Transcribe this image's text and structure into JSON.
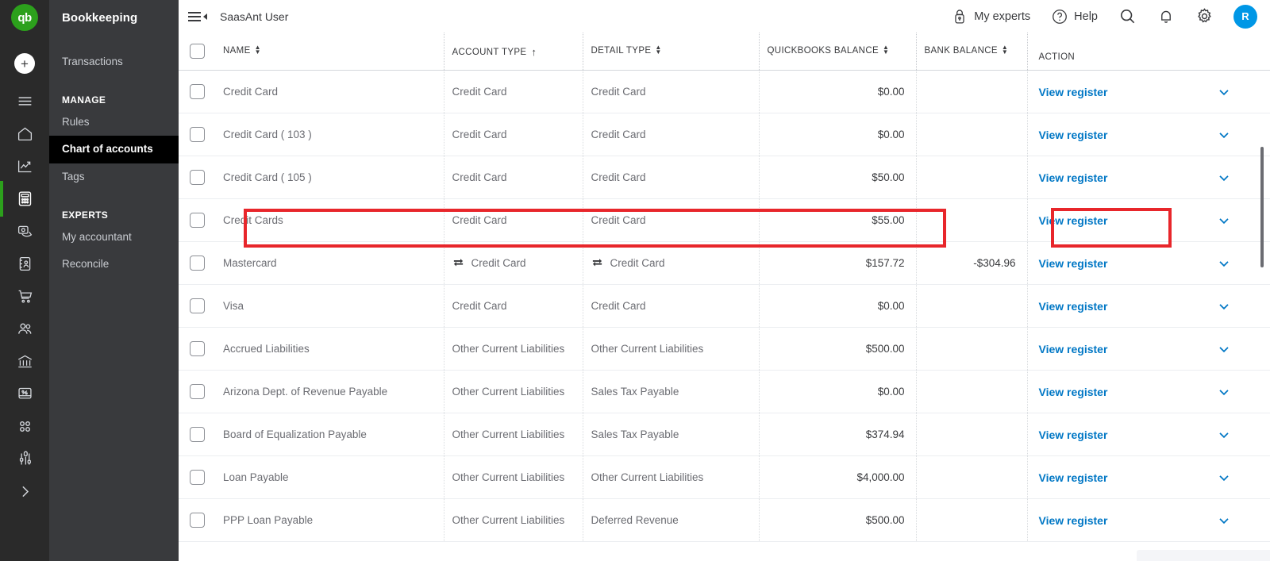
{
  "rail": {
    "logo_text": "qb",
    "add_label": "+",
    "icons": [
      {
        "name": "menu-icon",
        "label": "Menu"
      },
      {
        "name": "home-icon",
        "label": "Home"
      },
      {
        "name": "business-overview-icon",
        "label": "Business overview"
      },
      {
        "name": "bookkeeping-icon",
        "label": "Bookkeeping"
      },
      {
        "name": "sales-icon",
        "label": "Sales"
      },
      {
        "name": "expenses-icon",
        "label": "Expenses"
      },
      {
        "name": "cart-icon",
        "label": "Commerce"
      },
      {
        "name": "customers-icon",
        "label": "Customers & leads"
      },
      {
        "name": "payroll-icon",
        "label": "Payroll"
      },
      {
        "name": "taxes-icon",
        "label": "Taxes"
      },
      {
        "name": "apps-icon",
        "label": "Apps"
      },
      {
        "name": "tools-icon",
        "label": "My accountant"
      },
      {
        "name": "chevron-right-icon",
        "label": "Expand"
      }
    ]
  },
  "sidebar": {
    "title": "Bookkeeping",
    "items": [
      {
        "label": "Transactions",
        "selected": false,
        "section": false
      },
      {
        "label": "MANAGE",
        "selected": false,
        "section": true
      },
      {
        "label": "Rules",
        "selected": false,
        "section": false
      },
      {
        "label": "Chart of accounts",
        "selected": true,
        "section": false
      },
      {
        "label": "Tags",
        "selected": false,
        "section": false
      },
      {
        "label": "EXPERTS",
        "selected": false,
        "section": true
      },
      {
        "label": "My accountant",
        "selected": false,
        "section": false
      },
      {
        "label": "Reconcile",
        "selected": false,
        "section": false
      }
    ]
  },
  "topbar": {
    "company": "SaasAnt User",
    "my_experts": "My experts",
    "help": "Help",
    "avatar_initial": "R"
  },
  "table": {
    "columns": [
      {
        "label": "NAME",
        "sort": "both"
      },
      {
        "label": "ACCOUNT TYPE",
        "sort": "asc"
      },
      {
        "label": "DETAIL TYPE",
        "sort": "both"
      },
      {
        "label": "QUICKBOOKS BALANCE",
        "sort": "both"
      },
      {
        "label": "BANK BALANCE",
        "sort": "both"
      },
      {
        "label": "ACTION",
        "sort": "none"
      }
    ],
    "action_label": "View register",
    "rows": [
      {
        "name": "Credit Card",
        "account_type": "Credit Card",
        "detail_type": "Credit Card",
        "qb_balance": "$0.00",
        "bank_balance": "",
        "linked": false,
        "highlight": false
      },
      {
        "name": "Credit Card ( 103 )",
        "account_type": "Credit Card",
        "detail_type": "Credit Card",
        "qb_balance": "$0.00",
        "bank_balance": "",
        "linked": false,
        "highlight": false
      },
      {
        "name": "Credit Card ( 105 )",
        "account_type": "Credit Card",
        "detail_type": "Credit Card",
        "qb_balance": "$50.00",
        "bank_balance": "",
        "linked": false,
        "highlight": false
      },
      {
        "name": "Credit Cards",
        "account_type": "Credit Card",
        "detail_type": "Credit Card",
        "qb_balance": "$55.00",
        "bank_balance": "",
        "linked": false,
        "highlight": true
      },
      {
        "name": "Mastercard",
        "account_type": "Credit Card",
        "detail_type": "Credit Card",
        "qb_balance": "$157.72",
        "bank_balance": "-$304.96",
        "linked": true,
        "highlight": false
      },
      {
        "name": "Visa",
        "account_type": "Credit Card",
        "detail_type": "Credit Card",
        "qb_balance": "$0.00",
        "bank_balance": "",
        "linked": false,
        "highlight": false
      },
      {
        "name": "Accrued Liabilities",
        "account_type": "Other Current Liabilities",
        "detail_type": "Other Current Liabilities",
        "qb_balance": "$500.00",
        "bank_balance": "",
        "linked": false,
        "highlight": false
      },
      {
        "name": "Arizona Dept. of Revenue Payable",
        "account_type": "Other Current Liabilities",
        "detail_type": "Sales Tax Payable",
        "qb_balance": "$0.00",
        "bank_balance": "",
        "linked": false,
        "highlight": false
      },
      {
        "name": "Board of Equalization Payable",
        "account_type": "Other Current Liabilities",
        "detail_type": "Sales Tax Payable",
        "qb_balance": "$374.94",
        "bank_balance": "",
        "linked": false,
        "highlight": false
      },
      {
        "name": "Loan Payable",
        "account_type": "Other Current Liabilities",
        "detail_type": "Other Current Liabilities",
        "qb_balance": "$4,000.00",
        "bank_balance": "",
        "linked": false,
        "highlight": false
      },
      {
        "name": "PPP Loan Payable",
        "account_type": "Other Current Liabilities",
        "detail_type": "Deferred Revenue",
        "qb_balance": "$500.00",
        "bank_balance": "",
        "linked": false,
        "highlight": false
      }
    ]
  },
  "colors": {
    "accent_green": "#2CA01C",
    "link_blue": "#0077C5",
    "avatar_blue": "#0097E6",
    "annotation_red": "#E8262B",
    "nav_dark": "#393A3D",
    "rail_dark": "#2A2A2A",
    "selected_black": "#000000"
  }
}
